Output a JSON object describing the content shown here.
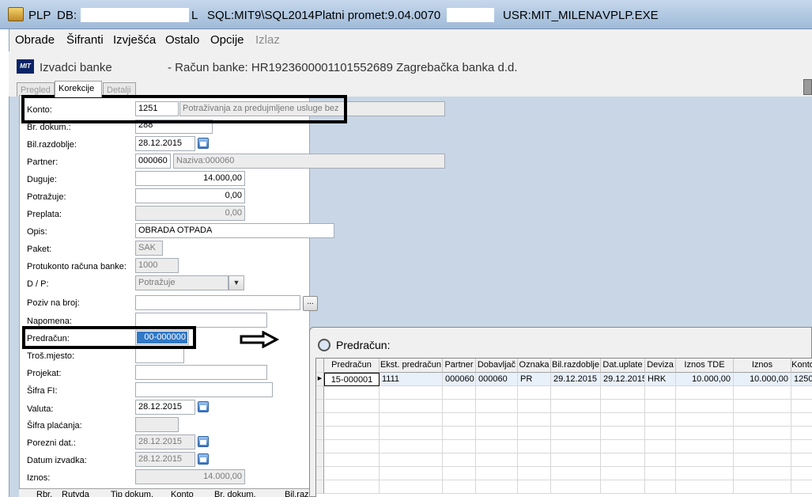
{
  "titlebar": {
    "app": "PLP",
    "db_label": "DB:",
    "db_suffix": "L",
    "sql": "SQL:MIT9\\SQL2014",
    "platni": "Platni promet:9.04.0070",
    "usr": "USR:MIT_MILENA",
    "exe": "VPLP.EXE"
  },
  "menu": [
    "Obrade",
    "Šifranti",
    "Izvješća",
    "Ostalo",
    "Opcije",
    "Izlaz"
  ],
  "window": {
    "title": "Izvadci banke",
    "account_info": "- Račun banke: HR1923600001101552689  Zagrebačka banka d.d.",
    "logo_text": "MIT"
  },
  "tabs": [
    "Pregled",
    "Korekcije",
    "Detalji"
  ],
  "form": {
    "konto_label": "Konto:",
    "konto_value": "1251",
    "konto_desc": "Potraživanja za predujmljene usluge bez",
    "brdokum_label": "Br. dokum.:",
    "brdokum_value": "288",
    "bilraz_label": "Bil.razdoblje:",
    "bilraz_value": "28.12.2015",
    "partner_label": "Partner:",
    "partner_value": "000060",
    "partner_desc": "Naziva:000060",
    "duguje_label": "Duguje:",
    "duguje_value": "14.000,00",
    "potrazuje_label": "Potražuje:",
    "potrazuje_value": "0,00",
    "preplata_label": "Preplata:",
    "preplata_value": "0,00",
    "opis_label": "Opis:",
    "opis_value": "OBRADA OTPADA",
    "paket_label": "Paket:",
    "paket_value": "SAK",
    "protukonto_label": "Protukonto računa banke:",
    "protukonto_value": "1000",
    "dp_label": "D / P:",
    "dp_value": "Potražuje",
    "poziv_label": "Poziv na broj:",
    "poziv_value": "",
    "poziv_btn": "...",
    "napomena_label": "Napomena:",
    "napomena_value": "",
    "predracun_label": "Predračun:",
    "predracun_value": "00-000000",
    "trosmjesto_label": "Troš.mjesto:",
    "projekat_label": "Projekat:",
    "sifrafi_label": "Šifra FI:",
    "valuta_label": "Valuta:",
    "valuta_value": "28.12.2015",
    "sifraplacanja_label": "Šifra plaćanja:",
    "porezni_label": "Porezni dat.:",
    "porezni_value": "28.12.2015",
    "datumizv_label": "Datum izvadka:",
    "datumizv_value": "28.12.2015",
    "iznos_label": "Iznos:",
    "iznos_value": "14.000,00"
  },
  "bottom_grid": [
    "Rbr.",
    "Rutvda",
    "Tip dokum.",
    "Konto",
    "Br. dokum.",
    "Bil.raz"
  ],
  "arrow": "⇨",
  "popup": {
    "title": "Predračun:",
    "columns": [
      "Predračun",
      "Ekst. predračun",
      "Partner",
      "Dobavljač",
      "Oznaka",
      "Bil.razdoblje",
      "Dat.uplate",
      "Deviza",
      "Iznos TDE",
      "Iznos",
      "Konto"
    ],
    "rows": [
      [
        "15-000001",
        "1111",
        "000060",
        "000060",
        "PR",
        "29.12.2015",
        "29.12.2015",
        "HRK",
        "10.000,00",
        "10.000,00",
        "1250"
      ]
    ]
  }
}
